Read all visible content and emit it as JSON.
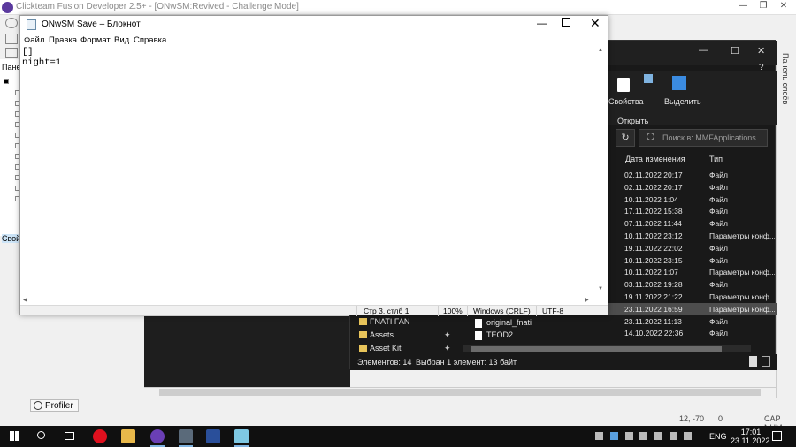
{
  "background_app": {
    "title": "Clickteam Fusion Developer 2.5+ - [ONwSM:Revived - Challenge Mode]",
    "panel_label": "Пане",
    "props_label": "Свой",
    "profiler_label": "Profiler",
    "coords": "12, -70",
    "object_count": "0",
    "caps": "CAP NUM",
    "layers_label": "Панель слоёв",
    "icons": [
      "clickteam-logo-icon",
      "search-icon",
      "profiler-icon"
    ]
  },
  "explorer": {
    "ribbon": {
      "properties": "Свойства",
      "open": "Открыть",
      "select": "Выделить"
    },
    "search_placeholder": "Поиск в: MMFApplications",
    "columns": {
      "date": "Дата изменения",
      "type": "Тип"
    },
    "rows": [
      {
        "date": "02.11.2022 20:17",
        "type": "Файл"
      },
      {
        "date": "02.11.2022 20:17",
        "type": "Файл"
      },
      {
        "date": "10.11.2022 1:04",
        "type": "Файл"
      },
      {
        "date": "17.11.2022 15:38",
        "type": "Файл"
      },
      {
        "date": "07.11.2022 11:44",
        "type": "Файл"
      },
      {
        "date": "10.11.2022 23:12",
        "type": "Параметры конф..."
      },
      {
        "date": "19.11.2022 22:02",
        "type": "Файл"
      },
      {
        "date": "10.11.2022 23:15",
        "type": "Файл"
      },
      {
        "date": "10.11.2022 1:07",
        "type": "Параметры конф..."
      },
      {
        "date": "03.11.2022 19:28",
        "type": "Файл"
      },
      {
        "date": "19.11.2022 21:22",
        "type": "Параметры конф..."
      },
      {
        "date": "23.11.2022 16:59",
        "type": "Параметры конф...",
        "selected": true
      },
      {
        "date": "23.11.2022 11:13",
        "type": "Файл"
      },
      {
        "date": "14.10.2022 22:36",
        "type": "Файл"
      }
    ],
    "nav": [
      "FNATI FAN",
      "Assets",
      "Asset Kit"
    ],
    "files": [
      "original_fnati",
      "TEOD2"
    ],
    "status_count": "Элементов: 14",
    "status_selected": "Выбран 1 элемент: 13 байт"
  },
  "notepad": {
    "title": "ONwSM Save – Блокнот",
    "menu": [
      "Файл",
      "Правка",
      "Формат",
      "Вид",
      "Справка"
    ],
    "content": "[]\nnight=1",
    "status": {
      "position": "Стр 3, стлб 1",
      "zoom": "100%",
      "eol": "Windows (CRLF)",
      "encoding": "UTF-8"
    }
  },
  "taskbar": {
    "lang": "ENG",
    "time": "17:01",
    "date": "23.11.2022",
    "apps": [
      "opera-icon",
      "file-explorer-icon",
      "clickteam-icon",
      "explorer-window-icon",
      "image-viewer-icon",
      "notepad-icon"
    ]
  }
}
